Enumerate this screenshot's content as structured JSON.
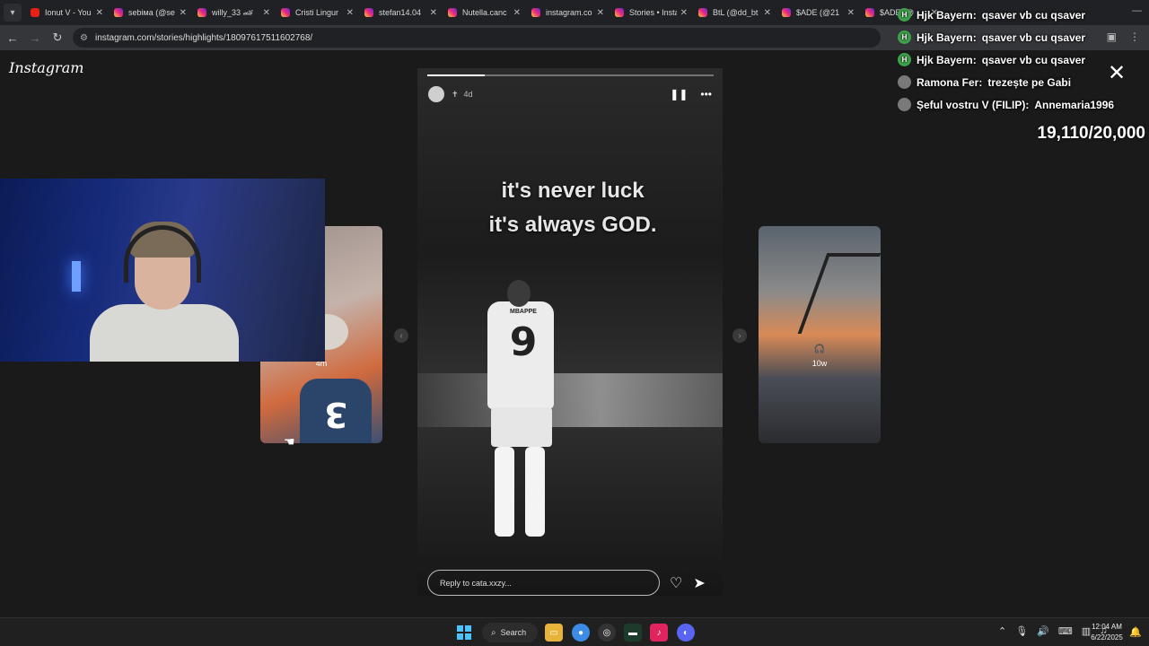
{
  "browser": {
    "tabs": [
      {
        "title": "Ionut V - You",
        "icon": "youtube-icon"
      },
      {
        "title": "sebiмa (@se",
        "icon": "instagram-icon"
      },
      {
        "title": "willy_33 🏎",
        "icon": "instagram-icon"
      },
      {
        "title": "Cristi Lingur",
        "icon": "instagram-icon"
      },
      {
        "title": "stefan14.04",
        "icon": "instagram-icon"
      },
      {
        "title": "Nutella.canc",
        "icon": "instagram-icon"
      },
      {
        "title": "instagram.co",
        "icon": "instagram-icon"
      },
      {
        "title": "Stories • Insta",
        "icon": "instagram-icon"
      },
      {
        "title": "BtL (@dd_bt",
        "icon": "instagram-icon"
      },
      {
        "title": "$ADE (@21",
        "icon": "instagram-icon"
      },
      {
        "title": "$ADE (@",
        "icon": "instagram-icon"
      }
    ],
    "url": "instagram.com/stories/highlights/18097617511602768/"
  },
  "instagram": {
    "logo": "Instagram",
    "left_story": {
      "time": "4m"
    },
    "right_story": {
      "time": "10w"
    },
    "main_story": {
      "time": "4d",
      "caption_line1": "it's never luck",
      "caption_line2": "it's always GOD.",
      "jersey_name": "MBAPPE",
      "jersey_number": "9",
      "progress": 0.2
    },
    "reply_placeholder": "Reply to cata.xxzy..."
  },
  "chat": {
    "messages": [
      {
        "user": "Hjk Bayern:",
        "text": "qsaver vb cu qsaver",
        "badge_color": "#3fa34d",
        "badge": "H"
      },
      {
        "user": "Hjk Bayern:",
        "text": "qsaver vb cu qsaver",
        "badge_color": "#3fa34d",
        "badge": "H"
      },
      {
        "user": "Hjk Bayern:",
        "text": "qsaver vb cu qsaver",
        "badge_color": "#3fa34d",
        "badge": "H"
      },
      {
        "user": "Ramona Fer:",
        "text": "trezește pe Gabi",
        "badge_color": "#7a7a7a",
        "badge": ""
      },
      {
        "user": "Șeful vostru V (FILIP):",
        "text": "Annemaria1996",
        "badge_color": "#7a7a7a",
        "badge": ""
      }
    ],
    "counter": "19,110/20,000"
  },
  "taskbar": {
    "search_label": "Search",
    "time": "12:04 AM",
    "date": "6/22/2025"
  },
  "colors": {
    "accent": "#4cc2ff",
    "page_bg": "#1a1a1a"
  }
}
